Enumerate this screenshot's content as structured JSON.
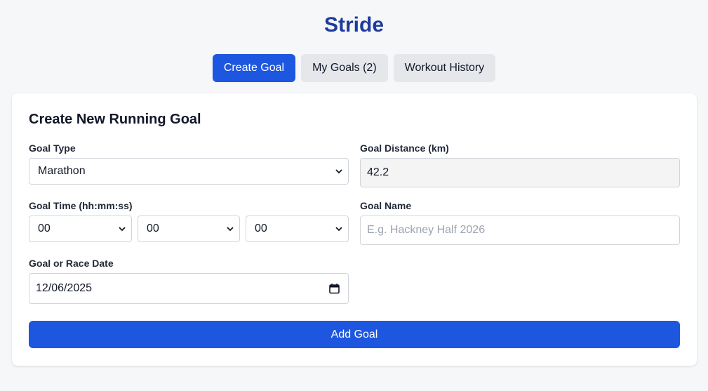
{
  "app": {
    "title": "Stride"
  },
  "tabs": [
    {
      "label": "Create Goal",
      "active": true
    },
    {
      "label": "My Goals (2)",
      "active": false
    },
    {
      "label": "Workout History",
      "active": false
    }
  ],
  "form": {
    "heading": "Create New Running Goal",
    "goal_type": {
      "label": "Goal Type",
      "value": "Marathon"
    },
    "goal_distance": {
      "label": "Goal Distance (km)",
      "value": "42.2"
    },
    "goal_time": {
      "label": "Goal Time (hh:mm:ss)",
      "hours": "00",
      "minutes": "00",
      "seconds": "00"
    },
    "goal_name": {
      "label": "Goal Name",
      "placeholder": "E.g. Hackney Half 2026"
    },
    "goal_date": {
      "label": "Goal or Race Date",
      "value": "12/06/2025"
    },
    "submit_label": "Add Goal"
  },
  "colors": {
    "accent": "#1d57e0",
    "title": "#1e3a9e",
    "background": "#f6f7f9",
    "tab_inactive": "#e5e7eb"
  },
  "icons": {
    "select": "chevron-down-icon",
    "date": "calendar-icon"
  }
}
